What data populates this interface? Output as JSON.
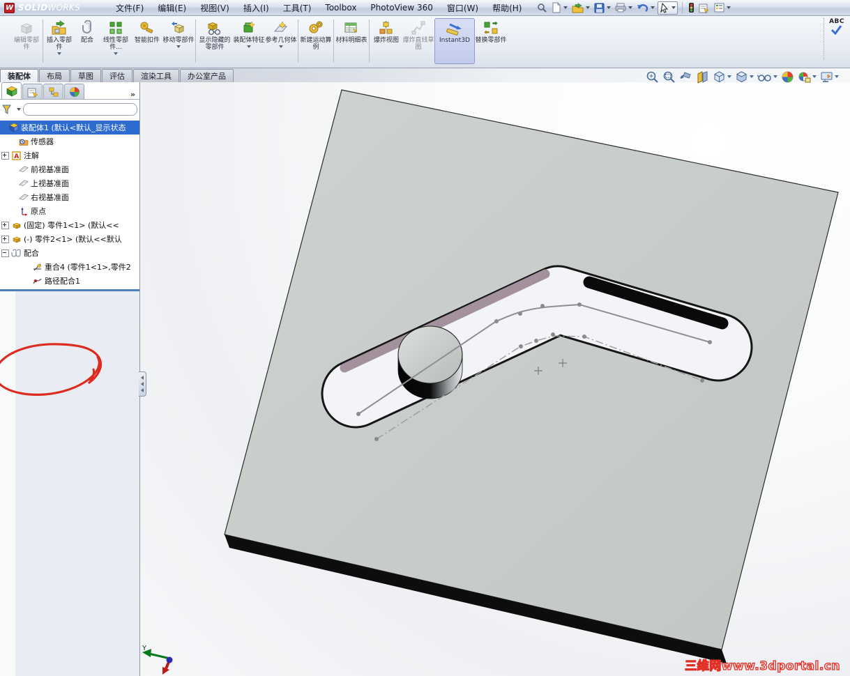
{
  "window": {
    "brand_bold": "SOLID",
    "brand_light": "WORKS",
    "logo_letter": "W"
  },
  "menu_bar": {
    "items": [
      {
        "label": "文件(F)"
      },
      {
        "label": "编辑(E)"
      },
      {
        "label": "视图(V)"
      },
      {
        "label": "插入(I)"
      },
      {
        "label": "工具(T)"
      },
      {
        "label": "Toolbox"
      },
      {
        "label": "PhotoView 360"
      },
      {
        "label": "窗口(W)"
      },
      {
        "label": "帮助(H)"
      }
    ],
    "quick_icons": [
      "search",
      "new-document",
      "open",
      "save",
      "print",
      "undo",
      "select-cursor",
      "traffic-light",
      "options-form",
      "task-pane"
    ]
  },
  "ribbon": {
    "buttons": [
      {
        "label": "编辑零部件",
        "state": "disabled",
        "dropdown": false
      },
      {
        "label": "插入零部件",
        "state": "normal",
        "dropdown": true
      },
      {
        "label": "配合",
        "state": "normal",
        "dropdown": false
      },
      {
        "label": "线性零部件...",
        "state": "normal",
        "dropdown": true
      },
      {
        "label": "智能扣件",
        "state": "normal",
        "dropdown": false
      },
      {
        "label": "移动零部件",
        "state": "normal",
        "dropdown": true
      },
      {
        "label": "显示隐藏的零部件",
        "state": "normal",
        "dropdown": false
      },
      {
        "label": "装配体特征",
        "state": "normal",
        "dropdown": true
      },
      {
        "label": "参考几何体",
        "state": "normal",
        "dropdown": true
      },
      {
        "label": "新建运动算例",
        "state": "normal",
        "dropdown": false
      },
      {
        "label": "材料明细表",
        "state": "normal",
        "dropdown": false
      },
      {
        "label": "爆炸视图",
        "state": "normal",
        "dropdown": false
      },
      {
        "label": "爆炸直线草图",
        "state": "disabled",
        "dropdown": false
      },
      {
        "label": "Instant3D",
        "state": "active",
        "dropdown": false
      },
      {
        "label": "替换零部件",
        "state": "normal",
        "dropdown": false
      }
    ],
    "spellcheck_label": "ABC"
  },
  "command_tabs": {
    "tabs": [
      {
        "label": "装配体",
        "active": true
      },
      {
        "label": "布局",
        "active": false
      },
      {
        "label": "草图",
        "active": false
      },
      {
        "label": "评估",
        "active": false
      },
      {
        "label": "渲染工具",
        "active": false
      },
      {
        "label": "办公室产品",
        "active": false
      }
    ]
  },
  "headsup_toolbar": {
    "icons": [
      "zoom-to-fit",
      "zoom-to-area",
      "previous-view",
      "section-view",
      "view-orientation",
      "display-style",
      "hide-show-items",
      "edit-appearance",
      "apply-scene",
      "view-settings"
    ]
  },
  "feature_panel": {
    "tab_icons": [
      "featuremanager-tree",
      "propertymanager",
      "configurationmanager",
      "displaymanager"
    ],
    "more_label": "»",
    "tree": [
      {
        "label": "装配体1 (默认<默认_显示状态",
        "icon": "assembly",
        "selected": true
      },
      {
        "label": "传感器",
        "icon": "sensors-folder"
      },
      {
        "label": "注解",
        "icon": "annotations"
      },
      {
        "label": "前视基准面",
        "icon": "plane"
      },
      {
        "label": "上视基准面",
        "icon": "plane"
      },
      {
        "label": "右视基准面",
        "icon": "plane"
      },
      {
        "label": "原点",
        "icon": "origin"
      },
      {
        "label": "(固定) 零件1<1> (默认<<",
        "icon": "part"
      },
      {
        "label": "(-) 零件2<1> (默认<<默认",
        "icon": "part"
      },
      {
        "label": "配合",
        "icon": "mates"
      },
      {
        "label": "重合4 (零件1<1>,零件2",
        "icon": "coincident-mate"
      },
      {
        "label": "路径配合1",
        "icon": "path-mate"
      }
    ]
  },
  "viewport": {
    "watermark": "三维网www.3dportal.cn",
    "triad_y_label": "Y"
  },
  "colors": {
    "selection_blue": "#2e6bd0",
    "instant3d_highlight": "#c2cbed",
    "plate_gray": "#c9cec9",
    "slot_wall_mauve": "#a3919e",
    "watermark_red": "#e03028",
    "annotation_red": "#dd2b20",
    "splitter_blue": "#4e7fc0"
  }
}
